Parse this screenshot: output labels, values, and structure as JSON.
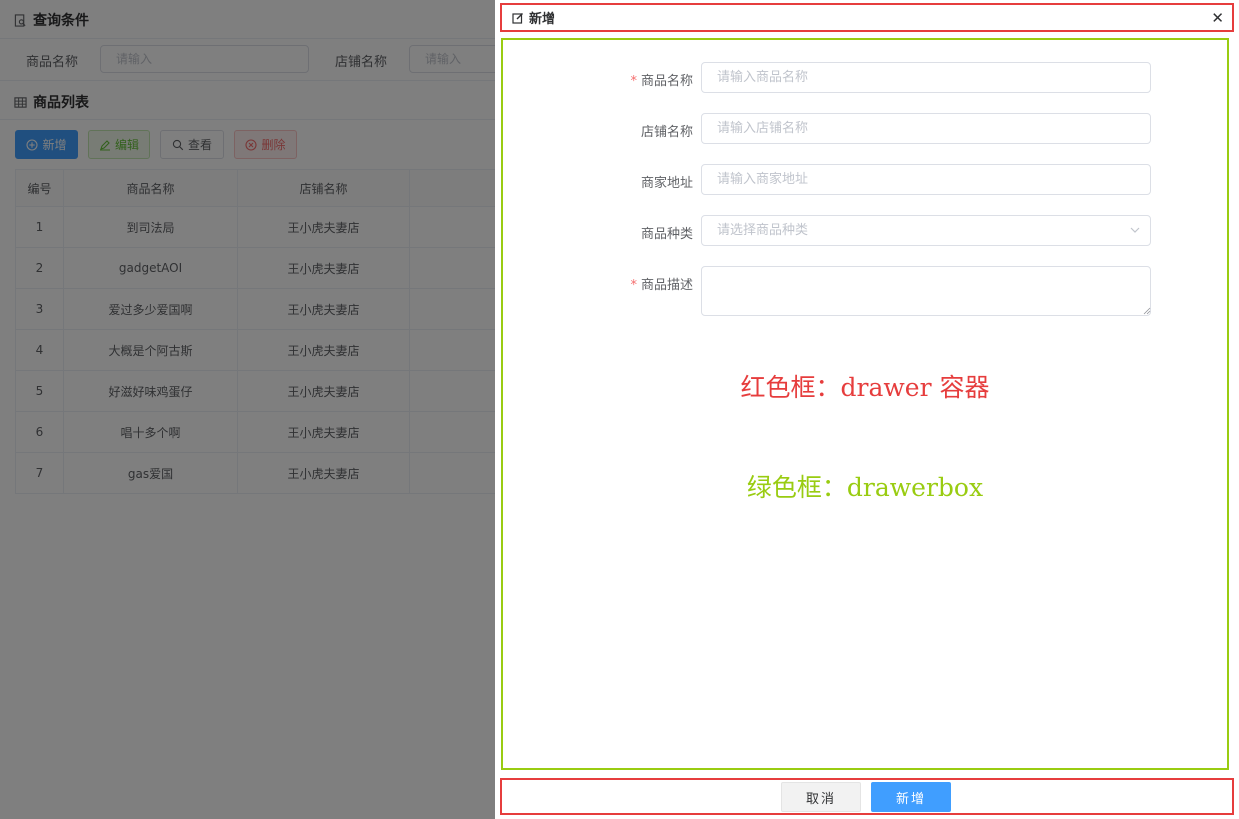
{
  "query": {
    "title": "查询条件",
    "product_name_label": "商品名称",
    "product_name_placeholder": "请输入",
    "shop_name_label": "店铺名称",
    "shop_name_placeholder": "请输入"
  },
  "list": {
    "title": "商品列表",
    "buttons": {
      "add": "新增",
      "edit": "编辑",
      "view": "查看",
      "delete": "删除"
    },
    "columns": [
      "编号",
      "商品名称",
      "店铺名称"
    ],
    "rows": [
      [
        "1",
        "到司法局",
        "王小虎夫妻店"
      ],
      [
        "2",
        "gadgetAOI",
        "王小虎夫妻店"
      ],
      [
        "3",
        "爱过多少爱国啊",
        "王小虎夫妻店"
      ],
      [
        "4",
        "大概是个阿古斯",
        "王小虎夫妻店"
      ],
      [
        "5",
        "好滋好味鸡蛋仔",
        "王小虎夫妻店"
      ],
      [
        "6",
        "唱十多个啊",
        "王小虎夫妻店"
      ],
      [
        "7",
        "gas爱国",
        "王小虎夫妻店"
      ]
    ]
  },
  "drawer": {
    "title": "新增",
    "close_icon": "close-icon",
    "fields": {
      "product_name": {
        "label": "商品名称",
        "required": true,
        "placeholder": "请输入商品名称"
      },
      "shop_name": {
        "label": "店铺名称",
        "required": false,
        "placeholder": "请输入店铺名称"
      },
      "merchant_address": {
        "label": "商家地址",
        "required": false,
        "placeholder": "请输入商家地址"
      },
      "product_category": {
        "label": "商品种类",
        "required": false,
        "placeholder": "请选择商品种类"
      },
      "product_desc": {
        "label": "商品描述",
        "required": true,
        "placeholder": ""
      }
    },
    "required_mark": "*",
    "note_red": "红色框：drawer 容器",
    "note_green": "绿色框：drawerbox",
    "cancel_label": "取消",
    "submit_label": "新增"
  },
  "colors": {
    "primary": "#409eff",
    "success": "#67c23a",
    "danger": "#f56c6c",
    "annotation_red": "#e63d3d",
    "annotation_green": "#99cc11"
  }
}
